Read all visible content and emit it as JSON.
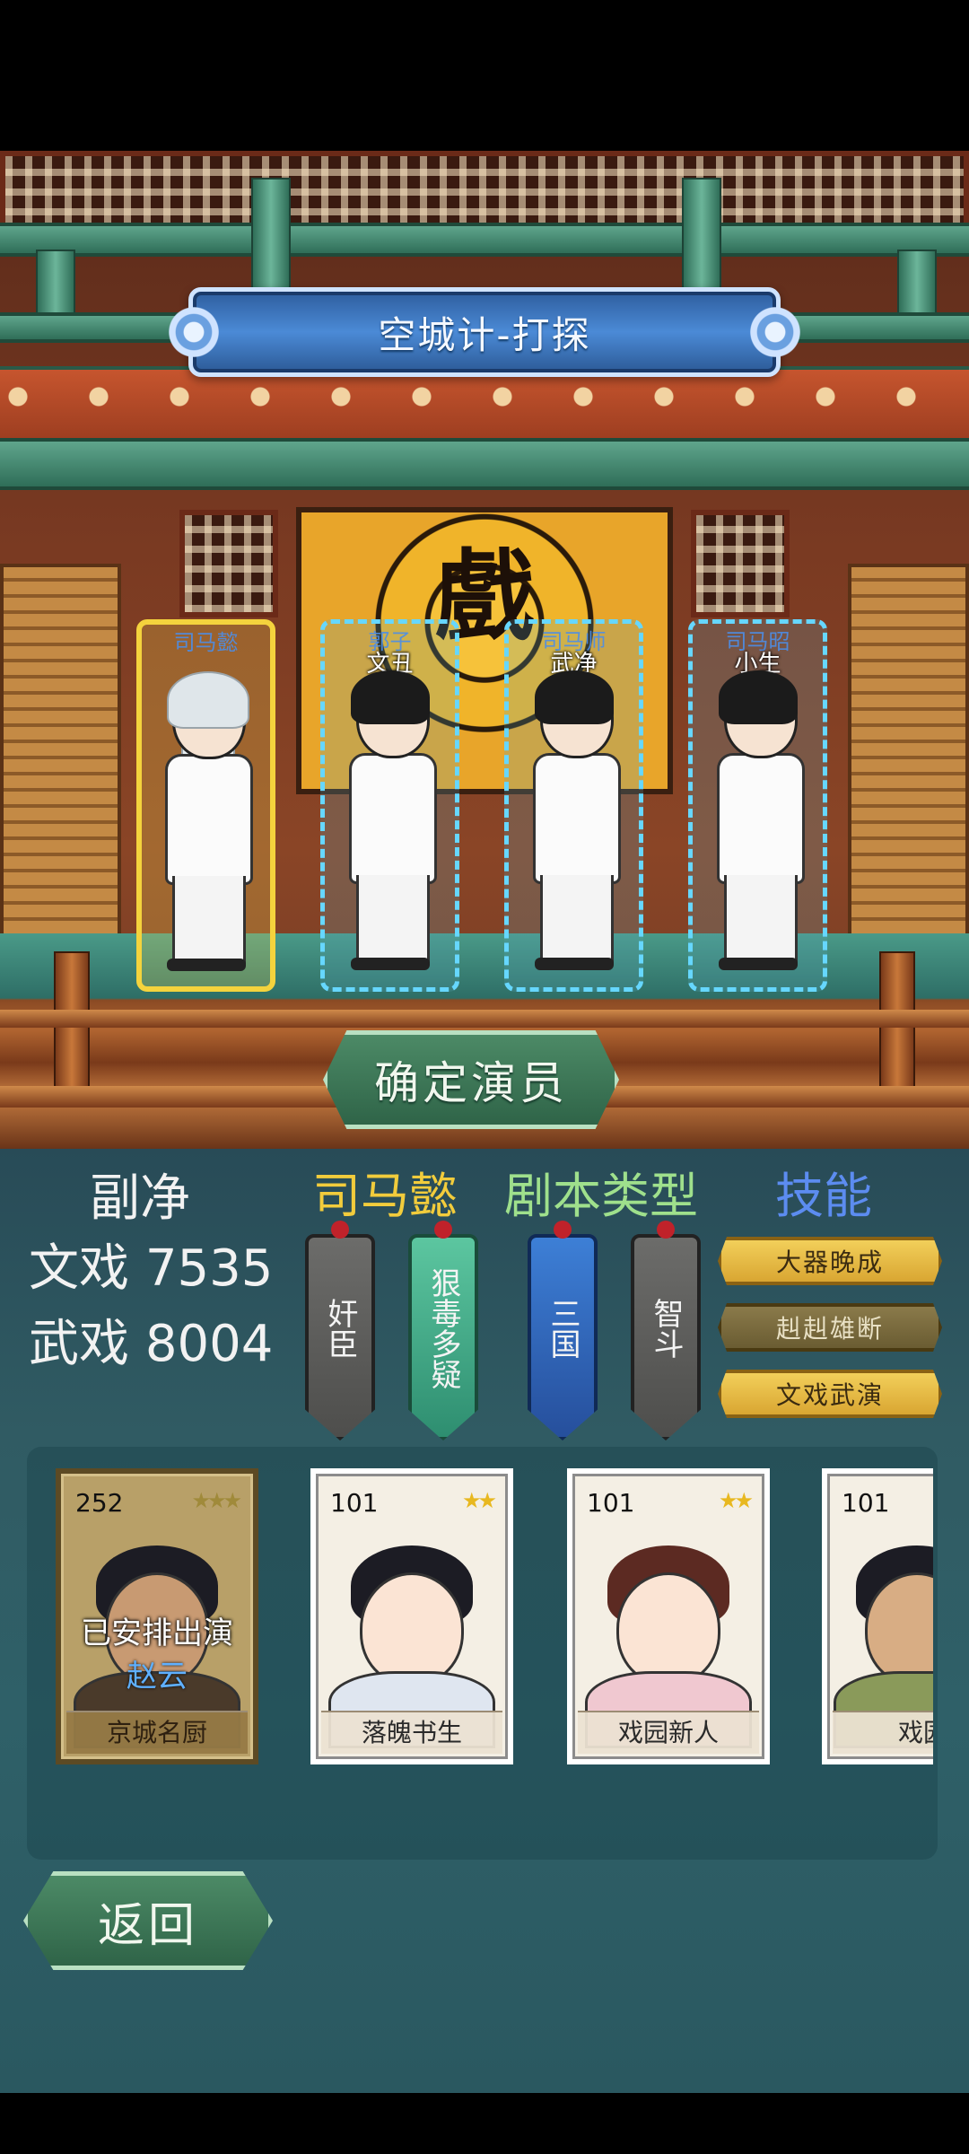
{
  "title": "空城计-打探",
  "stage_sign_char": "戲",
  "slots": [
    {
      "top_text": "司马懿",
      "role": "",
      "selected": true
    },
    {
      "top_text": "郭子",
      "role": "文丑",
      "selected": false
    },
    {
      "top_text": "司马师",
      "role": "武净",
      "selected": false
    },
    {
      "top_text": "司马昭",
      "role": "小生",
      "selected": false
    }
  ],
  "confirm_label": "确定演员",
  "info": {
    "role_type": "副净",
    "character": "司马懿",
    "script_type_label": "剧本类型",
    "skills_label": "技能",
    "wenxi_label": "文戏",
    "wenxi_value": "7535",
    "wuxi_label": "武戏",
    "wuxi_value": "8004"
  },
  "trait_tags": [
    {
      "text": "奸臣",
      "style": "gray"
    },
    {
      "text": "狠毒多疑",
      "style": "green"
    }
  ],
  "script_tags": [
    {
      "text": "三国",
      "style": "blue"
    },
    {
      "text": "智斗",
      "style": "gray"
    }
  ],
  "skills": [
    "大器晚成",
    "赳赳雄断",
    "文戏武演"
  ],
  "cards": [
    {
      "number": "252",
      "stars": "★★★",
      "name": "京城名厨",
      "assigned_text": "已安排出演",
      "assigned_actor": "赵云",
      "used": true
    },
    {
      "number": "101",
      "stars": "★★",
      "name": "落魄书生",
      "used": false
    },
    {
      "number": "101",
      "stars": "★★",
      "name": "戏园新人",
      "used": false
    },
    {
      "number": "101",
      "stars": "",
      "name": "戏园",
      "used": false
    }
  ],
  "back_label": "返回",
  "colors": {
    "character": "#f2cc3c",
    "script_type": "#9fe08c",
    "skills": "#5c8cf0",
    "slot_border": "#66d7ff",
    "slot_selected": "#f4d33d"
  }
}
